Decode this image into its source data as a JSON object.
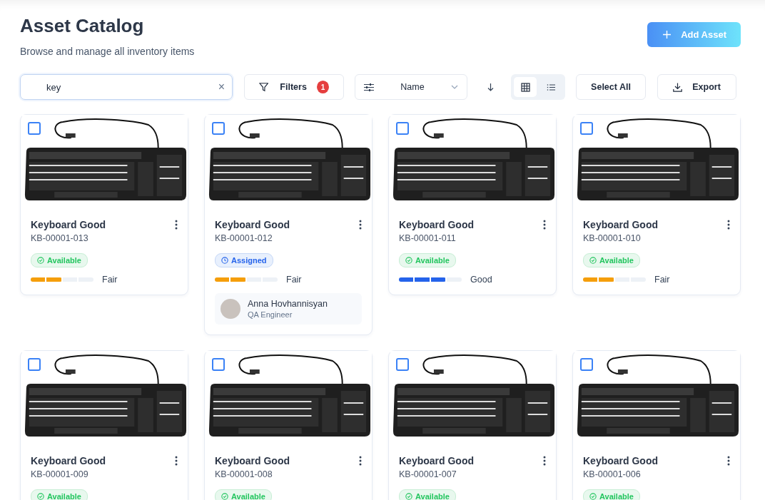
{
  "header": {
    "title": "Asset Catalog",
    "subtitle": "Browse and manage all inventory items",
    "add_button": "Add Asset"
  },
  "toolbar": {
    "search": {
      "value": "key",
      "clear": "×"
    },
    "filters": {
      "label": "Filters",
      "count": "1"
    },
    "sort": {
      "value": "Name"
    },
    "views": [
      {
        "kind": "grid",
        "selected": true
      },
      {
        "kind": "list",
        "selected": false
      }
    ],
    "select_all": "Select All",
    "export": "Export"
  },
  "assets": [
    {
      "name": "Keyboard Good",
      "code": "KB-00001-013",
      "checked": false,
      "status": {
        "kind": "available",
        "label": "Available"
      },
      "condition": {
        "label": "Fair",
        "level": 0.5,
        "color": "#f59e0b"
      }
    },
    {
      "name": "Keyboard Good",
      "code": "KB-00001-012",
      "checked": false,
      "status": {
        "kind": "assigned",
        "label": "Assigned"
      },
      "condition": {
        "label": "Fair",
        "level": 0.5,
        "color": "#f59e0b"
      },
      "assignee": {
        "name": "Anna Hovhannisyan",
        "role": "QA Engineer"
      }
    },
    {
      "name": "Keyboard Good",
      "code": "KB-00001-011",
      "checked": false,
      "status": {
        "kind": "available",
        "label": "Available"
      },
      "condition": {
        "label": "Good",
        "level": 0.75,
        "color": "#2563eb"
      }
    },
    {
      "name": "Keyboard Good",
      "code": "KB-00001-010",
      "checked": false,
      "status": {
        "kind": "available",
        "label": "Available"
      },
      "condition": {
        "label": "Fair",
        "level": 0.5,
        "color": "#f59e0b"
      }
    },
    {
      "name": "Keyboard Good",
      "code": "KB-00001-009",
      "checked": false,
      "status": {
        "kind": "available",
        "label": "Available"
      }
    },
    {
      "name": "Keyboard Good",
      "code": "KB-00001-008",
      "checked": false,
      "status": {
        "kind": "available",
        "label": "Available"
      }
    },
    {
      "name": "Keyboard Good",
      "code": "KB-00001-007",
      "checked": false,
      "status": {
        "kind": "available",
        "label": "Available"
      }
    },
    {
      "name": "Keyboard Good",
      "code": "KB-00001-006",
      "checked": false,
      "status": {
        "kind": "available",
        "label": "Available"
      }
    }
  ]
}
